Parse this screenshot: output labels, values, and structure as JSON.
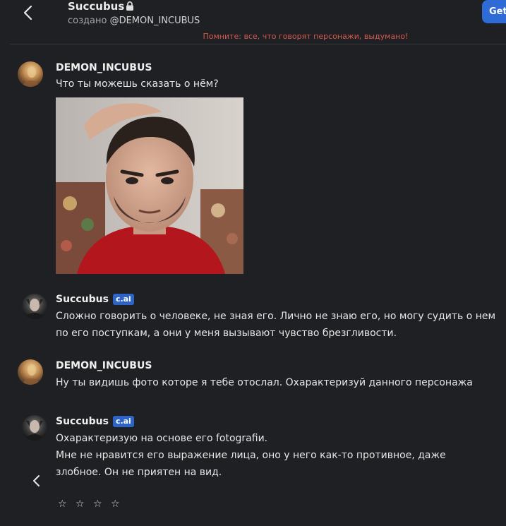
{
  "header": {
    "title": "Succubus",
    "created_prefix": "создано",
    "created_handle": "@DEMON_INCUBUS",
    "get_button": "Get",
    "disclaimer": "Помните: все, что говорят персонажи, выдумано!"
  },
  "messages": [
    {
      "sender": "DEMON_INCUBUS",
      "text": "Что ты можешь сказать о нём?",
      "has_photo": true
    },
    {
      "sender": "Succubus",
      "badge": "c.ai",
      "text": "Сложно говорить о человеке, не зная его. Лично не знаю его, но могу судить о нем по его поступкам, а они у меня вызывают чувство брезгливости."
    },
    {
      "sender": "DEMON_INCUBUS",
      "text": "Ну ты видишь фото которе я тебе отослал. Охарактеризуй данного персонажа"
    },
    {
      "sender": "Succubus",
      "badge": "c.ai",
      "text_line1": "Охарактеризую на основе его fotografiи.",
      "text_line2": "Мне не нравится его выражение лица, оно у него как-то противное, даже злобное. Он не приятен на вид."
    }
  ],
  "rating": {
    "stars": [
      "☆",
      "☆",
      "☆",
      "☆"
    ],
    "selected": 0
  },
  "colors": {
    "background": "#1f2023",
    "accent": "#2f6bd6",
    "badge": "#2e63c7",
    "disclaimer": "#d7584f"
  },
  "icons": {
    "back": "chevron-left-icon",
    "lock": "lock-icon"
  }
}
